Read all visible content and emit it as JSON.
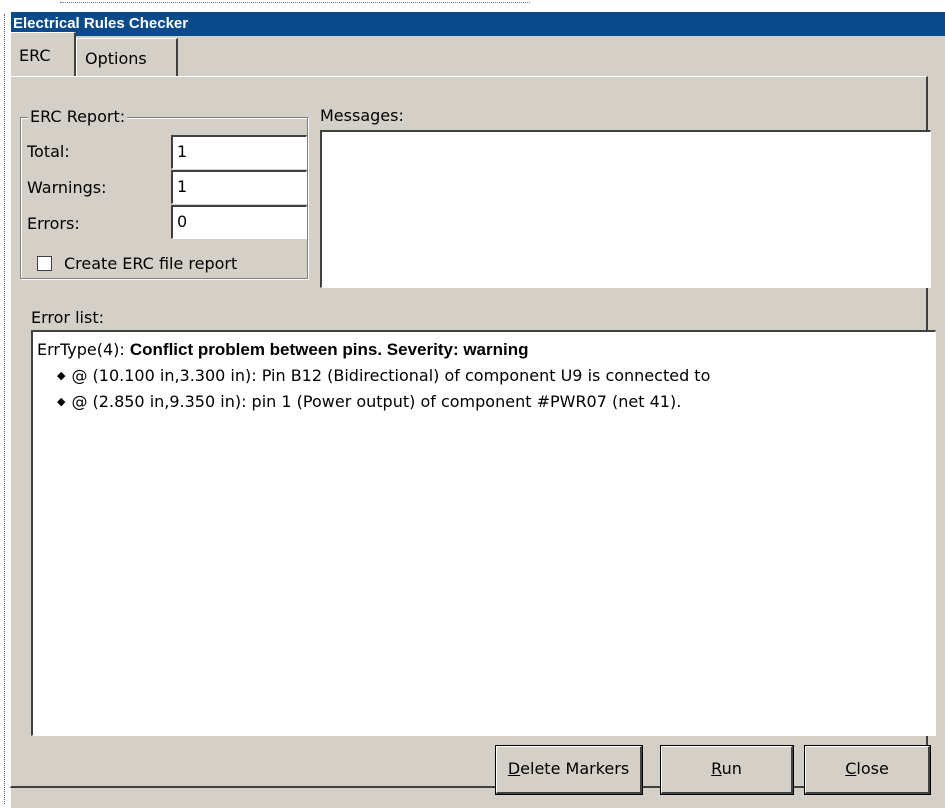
{
  "window": {
    "title": "Electrical Rules Checker"
  },
  "tabs": [
    {
      "label": "ERC",
      "active": true
    },
    {
      "label": "Options",
      "active": false
    }
  ],
  "erc_report": {
    "group_label": "ERC Report:",
    "total_label": "Total:",
    "total_value": "1",
    "warnings_label": "Warnings:",
    "warnings_value": "1",
    "errors_label": "Errors:",
    "errors_value": "0",
    "create_report_label": "Create ERC file report",
    "create_report_checked": false
  },
  "messages": {
    "label": "Messages:",
    "text": ""
  },
  "error_list": {
    "label": "Error list:",
    "entries": [
      {
        "type_prefix": "ErrType(4): ",
        "title": "Conflict problem between pins. Severity: warning",
        "items": [
          "@ (10.100 in,3.300 in): Pin B12 (Bidirectional) of component U9 is connected to",
          "@ (2.850 in,9.350 in): pin 1 (Power output) of component #PWR07 (net 41)."
        ]
      }
    ]
  },
  "buttons": {
    "delete_markers": {
      "mnemonic": "D",
      "rest": "elete Markers"
    },
    "run": {
      "mnemonic": "R",
      "rest": "un"
    },
    "close": {
      "mnemonic": "C",
      "rest": "lose"
    }
  },
  "colors": {
    "titlebar": "#0b4a8a",
    "dialog_bg": "#d4d0c8"
  }
}
